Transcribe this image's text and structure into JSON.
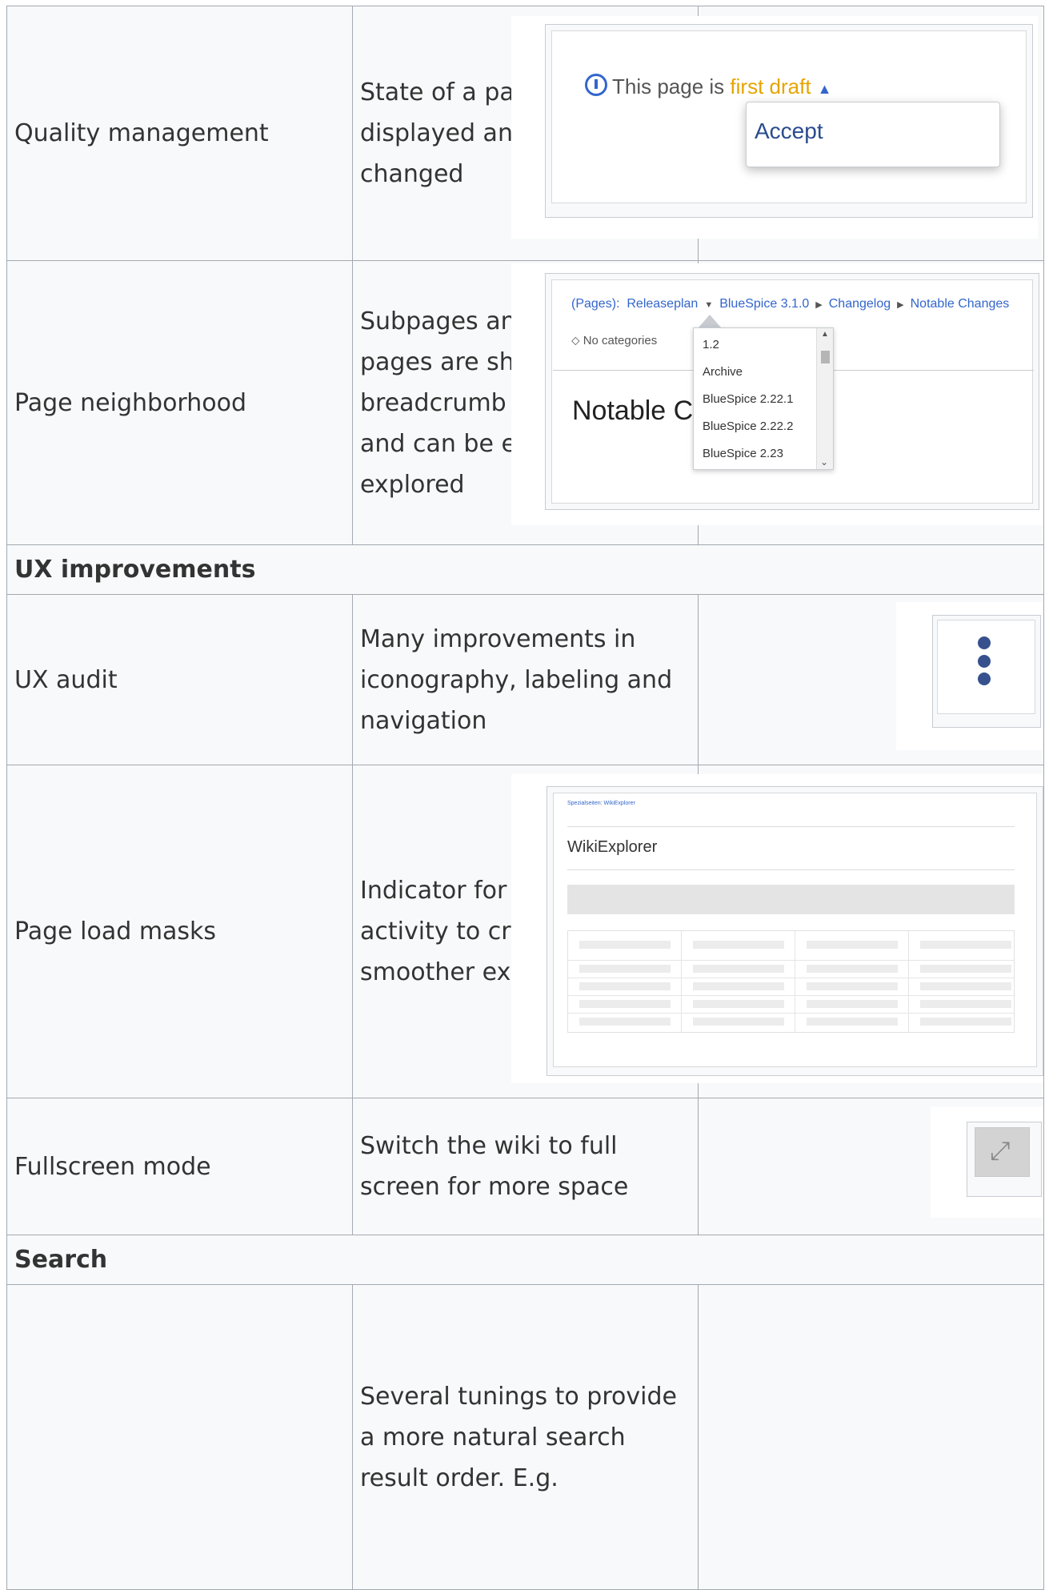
{
  "rows": [
    {
      "feature": "Quality management",
      "description": "State of a page is displayed and can be changed"
    },
    {
      "feature": "Page neighborhood",
      "description": "Subpages and related pages are shown in a breadcrumb navigation and can be easily be explored"
    },
    {
      "section": "UX improvements"
    },
    {
      "feature": "UX audit",
      "description": "Many improvements in iconography, labeling and navigation"
    },
    {
      "feature": "Page load masks",
      "description": "Indicator for system activity to create a smoother experience"
    },
    {
      "feature": "Fullscreen mode",
      "description": "Switch the wiki to full screen for more space"
    },
    {
      "section": "Search"
    },
    {
      "feature": "",
      "description": "Several tunings to provide a more natural search result order. E.g."
    }
  ],
  "quality_shot": {
    "prefix": "This page is",
    "state": "first draft",
    "menu_item": "Accept",
    "state_color": "#e6a400"
  },
  "breadcrumb_shot": {
    "prefix": "(Pages):",
    "crumbs": [
      "Releaseplan",
      "BlueSpice 3.1.0",
      "Changelog",
      "Notable Changes"
    ],
    "categories": "No categories",
    "heading": "Notable C",
    "options": [
      "1.2",
      "Archive",
      "BlueSpice 2.22.1",
      "BlueSpice 2.22.2",
      "BlueSpice 2.23"
    ]
  },
  "wiki_shot": {
    "breadcrumb": "Spezialseiten:  WikiExplorer",
    "title": "WikiExplorer"
  },
  "icons": {
    "more": "more-vertical-icon",
    "fullscreen": "fullscreen-expand-icon",
    "accent": "#36518d"
  }
}
